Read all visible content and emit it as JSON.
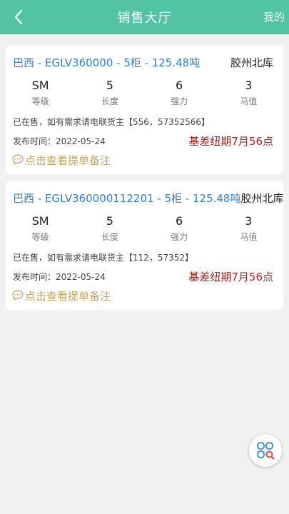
{
  "header": {
    "title": "销售大厅",
    "right_label": "我的",
    "back_icon": "chevron-left-icon"
  },
  "listings": [
    {
      "product": "巴西 - EGLV360000 - 5柜 - 125.48吨",
      "location": "胶州北库",
      "specs": [
        {
          "value": "SM",
          "label": "等级"
        },
        {
          "value": "5",
          "label": "长度"
        },
        {
          "value": "6",
          "label": "强力"
        },
        {
          "value": "3",
          "label": "马值"
        }
      ],
      "status": "已在售，如有需求请电联货主【556，57352566】",
      "publish_date": "发布时间：2022-05-24",
      "basis": "基差纽期7月56点",
      "remark": "点击查看提单备注"
    },
    {
      "product": "巴西 - EGLV360000112201 - 5柜 - 125.48吨",
      "location": "胶州北库",
      "specs": [
        {
          "value": "SM",
          "label": "等级"
        },
        {
          "value": "5",
          "label": "长度"
        },
        {
          "value": "6",
          "label": "强力"
        },
        {
          "value": "3",
          "label": "马值"
        }
      ],
      "status": "已在售，如有需求请电联货主【112，57352】",
      "publish_date": "发布时间：2022-05-24",
      "basis": "基差纽期7月56点",
      "remark": "点击查看提单备注"
    }
  ],
  "colors": {
    "header_bg": "#52c4a4",
    "link_blue": "#2f7fd8",
    "basis_red": "#b5201a",
    "remark_gold": "#c4a46a"
  },
  "fab": {
    "icon": "app-search-icon"
  }
}
